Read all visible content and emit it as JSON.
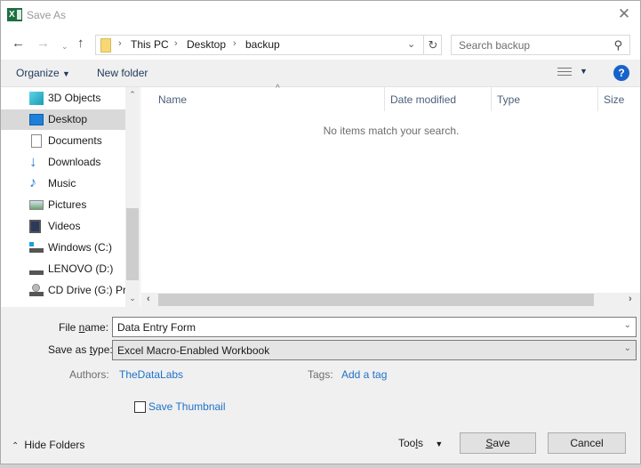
{
  "window": {
    "title": "Save As",
    "app_icon": "excel-icon",
    "close_icon": "close-icon"
  },
  "navigation": {
    "back_icon": "back-arrow-icon",
    "forward_icon": "forward-arrow-icon",
    "recent_icon": "chevron-down-icon",
    "up_icon": "up-arrow-icon",
    "breadcrumb": [
      "This PC",
      "Desktop",
      "backup"
    ],
    "refresh_icon": "refresh-icon",
    "search_placeholder": "Search backup",
    "search_icon": "search-icon"
  },
  "toolbar": {
    "organize_label": "Organize",
    "new_folder_label": "New folder",
    "view_icon": "details-view-icon",
    "help_icon": "help-icon",
    "help_glyph": "?"
  },
  "sidebar": {
    "items": [
      {
        "label": "3D Objects",
        "icon": "3d-objects-icon",
        "selected": false
      },
      {
        "label": "Desktop",
        "icon": "desktop-icon",
        "selected": true
      },
      {
        "label": "Documents",
        "icon": "documents-icon",
        "selected": false
      },
      {
        "label": "Downloads",
        "icon": "downloads-icon",
        "selected": false
      },
      {
        "label": "Music",
        "icon": "music-icon",
        "selected": false
      },
      {
        "label": "Pictures",
        "icon": "pictures-icon",
        "selected": false
      },
      {
        "label": "Videos",
        "icon": "videos-icon",
        "selected": false
      },
      {
        "label": "Windows (C:)",
        "icon": "windows-drive-icon",
        "selected": false
      },
      {
        "label": "LENOVO (D:)",
        "icon": "drive-icon",
        "selected": false
      },
      {
        "label": "CD Drive (G:) Pro",
        "icon": "cd-drive-icon",
        "selected": false
      }
    ]
  },
  "filelist": {
    "columns": [
      "Name",
      "Date modified",
      "Type",
      "Size"
    ],
    "empty_message": "No items match your search."
  },
  "form": {
    "file_name_label_pre": "File ",
    "file_name_label_u": "n",
    "file_name_label_post": "ame:",
    "file_name_value": "Data Entry Form",
    "save_type_label_pre": "Save as ",
    "save_type_label_u": "t",
    "save_type_label_post": "ype:",
    "save_type_value": "Excel Macro-Enabled Workbook",
    "authors_label": "Authors:",
    "authors_value": "TheDataLabs",
    "tags_label": "Tags:",
    "tags_value": "Add a tag",
    "thumbnail_label": "Save Thumbnail",
    "thumbnail_checked": false
  },
  "footer": {
    "hide_folders_label": "Hide Folders",
    "tools_pre": "Too",
    "tools_u": "l",
    "tools_post": "s",
    "save_u": "S",
    "save_post": "ave",
    "cancel_label": "Cancel"
  },
  "colors": {
    "accent_link": "#1e72c8",
    "selected_bg": "#d9d9d9",
    "excel_green": "#1d6f42",
    "help_blue": "#1863c8"
  }
}
